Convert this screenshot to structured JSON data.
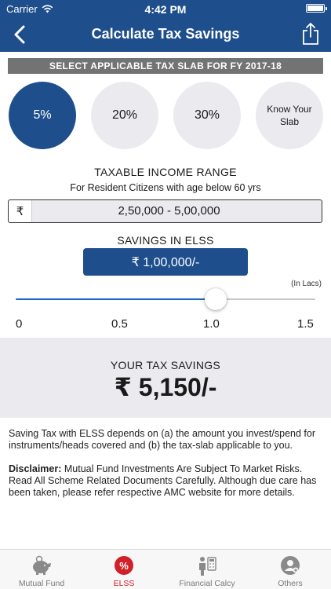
{
  "status": {
    "carrier": "Carrier",
    "time": "4:42 PM"
  },
  "header": {
    "title": "Calculate Tax Savings",
    "back_icon": "chevron-left-icon",
    "share_icon": "share-icon"
  },
  "banner": "SELECT APPLICABLE TAX SLAB FOR FY 2017-18",
  "slabs": [
    {
      "label": "5%",
      "selected": true
    },
    {
      "label": "20%",
      "selected": false
    },
    {
      "label": "30%",
      "selected": false
    },
    {
      "label": "Know Your Slab",
      "selected": false
    }
  ],
  "income": {
    "title": "TAXABLE INCOME RANGE",
    "subtitle": "For Resident Citizens with age below 60 yrs",
    "currency": "₹",
    "value": "2,50,000 - 5,00,000"
  },
  "savings": {
    "label": "SAVINGS IN ELSS",
    "amount": "₹ 1,00,000/-",
    "unit": "(In Lacs)",
    "slider": {
      "min": 0,
      "max": 1.5,
      "value": 1.0,
      "ticks": [
        "0",
        "0.5",
        "1.0",
        "1.5"
      ]
    }
  },
  "tax": {
    "label": "YOUR TAX SAVINGS",
    "value": "₹ 5,150/-"
  },
  "note": "Saving Tax with ELSS depends on (a) the amount you invest/spend for instruments/heads covered and (b) the tax-slab applicable to you.",
  "disclaimer": {
    "heading": "Disclaimer:",
    "text": " Mutual Fund Investments Are Subject To Market Risks. Read All Scheme Related Documents Carefully. Although due care has been taken, please refer respective AMC website for more details."
  },
  "tabs": [
    {
      "label": "Mutual Fund",
      "icon": "piggy-bank-icon"
    },
    {
      "label": "ELSS",
      "icon": "percent-badge-icon",
      "active": true
    },
    {
      "label": "Financial Calcy",
      "icon": "calculator-person-icon"
    },
    {
      "label": "Others",
      "icon": "user-plus-icon"
    }
  ],
  "colors": {
    "primary": "#1e4e8c",
    "slider": "#1e66c9",
    "active_tab": "#d0202a",
    "banner": "#737373",
    "panel": "#ebebef"
  }
}
